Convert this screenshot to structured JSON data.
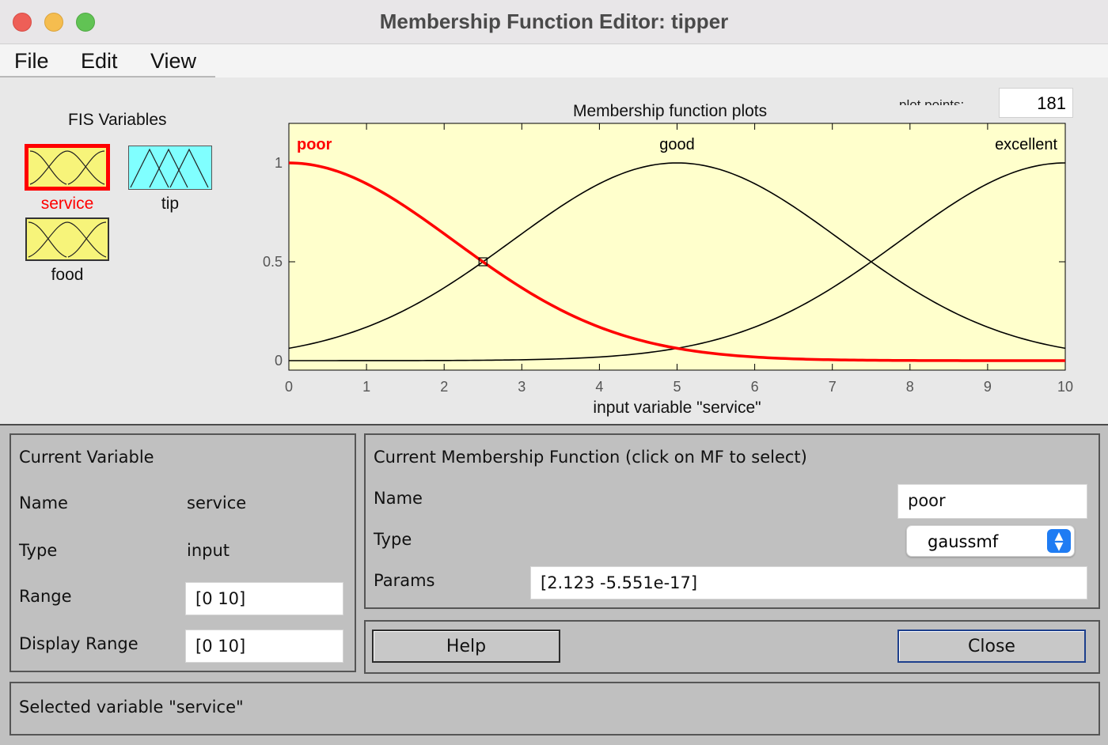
{
  "window": {
    "title": "Membership Function Editor: tipper"
  },
  "menu": {
    "file": "File",
    "edit": "Edit",
    "view": "View"
  },
  "fis_variables": {
    "title": "FIS Variables",
    "items": [
      {
        "label": "service",
        "kind": "input",
        "selected": true,
        "color": "#f7f47a",
        "label_color": "#ff0000"
      },
      {
        "label": "tip",
        "kind": "output",
        "selected": false,
        "color": "#80ffff",
        "label_color": "#111111"
      },
      {
        "label": "food",
        "kind": "input",
        "selected": false,
        "color": "#f7f47a",
        "label_color": "#111111"
      }
    ]
  },
  "plot": {
    "title": "Membership function plots",
    "plot_points_label": "plot points:",
    "plot_points_value": "181"
  },
  "chart_data": {
    "type": "line",
    "title": "Membership function plots",
    "xlabel": "input variable \"service\"",
    "ylabel": "",
    "xlim": [
      0,
      10
    ],
    "ylim": [
      0,
      1
    ],
    "xticks": [
      "0",
      "1",
      "2",
      "3",
      "4",
      "5",
      "6",
      "7",
      "8",
      "9",
      "10"
    ],
    "yticks": [
      "0",
      "0.5",
      "1"
    ],
    "background": "#ffffcc",
    "series": [
      {
        "name": "poor",
        "function": "gaussmf",
        "sigma": 2.123,
        "center": 0,
        "color": "#ff0000",
        "selected": true
      },
      {
        "name": "good",
        "function": "gaussmf",
        "sigma": 2.123,
        "center": 5,
        "color": "#000000",
        "selected": false
      },
      {
        "name": "excellent",
        "function": "gaussmf",
        "sigma": 2.123,
        "center": 10,
        "color": "#000000",
        "selected": false
      }
    ],
    "marker": {
      "x": 2.5,
      "y": 0.5
    }
  },
  "current_variable": {
    "title": "Current Variable",
    "name_label": "Name",
    "name_value": "service",
    "type_label": "Type",
    "type_value": "input",
    "range_label": "Range",
    "range_value": "[0 10]",
    "display_range_label": "Display Range",
    "display_range_value": "[0 10]"
  },
  "current_mf": {
    "title": "Current Membership Function (click on MF to select)",
    "name_label": "Name",
    "name_value": "poor",
    "type_label": "Type",
    "type_value": "gaussmf",
    "params_label": "Params",
    "params_value": "[2.123 -5.551e-17]"
  },
  "buttons": {
    "help": "Help",
    "close": "Close"
  },
  "status": {
    "text": "Selected variable \"service\""
  }
}
